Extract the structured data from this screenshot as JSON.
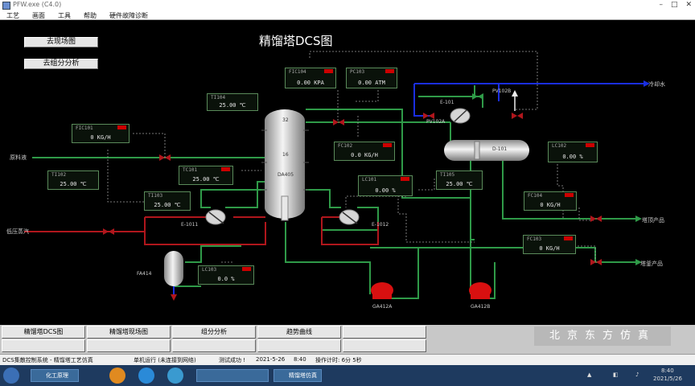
{
  "window": {
    "title": "PFW.exe  (C4.0)",
    "controls": [
      "–",
      "□",
      "✕"
    ]
  },
  "menu": [
    "工艺",
    "画面",
    "工具",
    "帮助",
    "硬件故障诊断"
  ],
  "nav_buttons": {
    "field": "去现场图",
    "composition": "去组分分析"
  },
  "main_title": "精馏塔DCS图",
  "tags": {
    "fic104": {
      "name": "FIC104",
      "value": "0.00 KPA"
    },
    "pc103": {
      "name": "PC103",
      "value": "0.00 ATM"
    },
    "ti104": {
      "name": "TI104",
      "value": "25.00 ℃"
    },
    "fic101": {
      "name": "FIC101",
      "value": "0 KG/H"
    },
    "ti102": {
      "name": "TI102",
      "value": "25.00 ℃"
    },
    "tc101": {
      "name": "TC101",
      "value": "25.00 ℃"
    },
    "ti103": {
      "name": "TI103",
      "value": "25.00 ℃"
    },
    "fc102": {
      "name": "FC102",
      "value": "0.0 KG/H"
    },
    "lc101": {
      "name": "LC101",
      "value": "0.00 %"
    },
    "lc102": {
      "name": "LC102",
      "value": "0.00 %"
    },
    "ti105": {
      "name": "TI105",
      "value": "25.00 ℃"
    },
    "fc104": {
      "name": "FC104",
      "value": "0 KG/H"
    },
    "fc103": {
      "name": "FC103",
      "value": "0 KG/H"
    },
    "lc103": {
      "name": "LC103",
      "value": "0.0 %"
    }
  },
  "labels": {
    "feed": "原料液",
    "steam": "低压蒸汽",
    "cooling_water": "冷却水",
    "top_product": "塔顶产品",
    "bottom_product": "塔釜产品",
    "condenser": "E-101",
    "reflux_tank": "D-101",
    "reboiler_1": "E-1011",
    "reboiler_2": "E-1012",
    "vessel": "FA414",
    "column": "DA405",
    "tray_top": "32",
    "tray_feed": "16",
    "pump_a": "GA412A",
    "pump_b": "GA412B",
    "pc_valve": "PV102A",
    "pc_valve_b": "PV102B"
  },
  "bottom_buttons": [
    "精馏塔DCS图",
    "精馏塔现场图",
    "组分分析",
    "趋势曲线"
  ],
  "logo": "北京东方仿真",
  "statusbar": {
    "system": "DCS集散控制系统 - 精馏塔工艺仿真",
    "mode": "单机运行 (未连接到网络)",
    "status": "测试成功 !",
    "date": "2021-5-26",
    "time": "8:40",
    "elapsed": "操作计时: 6分 5秒"
  },
  "taskbar": {
    "tasks": [
      "化工原理",
      "精馏塔仿真"
    ],
    "clock": "8:40",
    "date": "2021/5/26"
  },
  "colors": {
    "pipe_green": "#2f9a48",
    "pipe_red": "#b0161c",
    "pipe_blue": "#1a2ee0",
    "pump_red": "#d81010"
  }
}
